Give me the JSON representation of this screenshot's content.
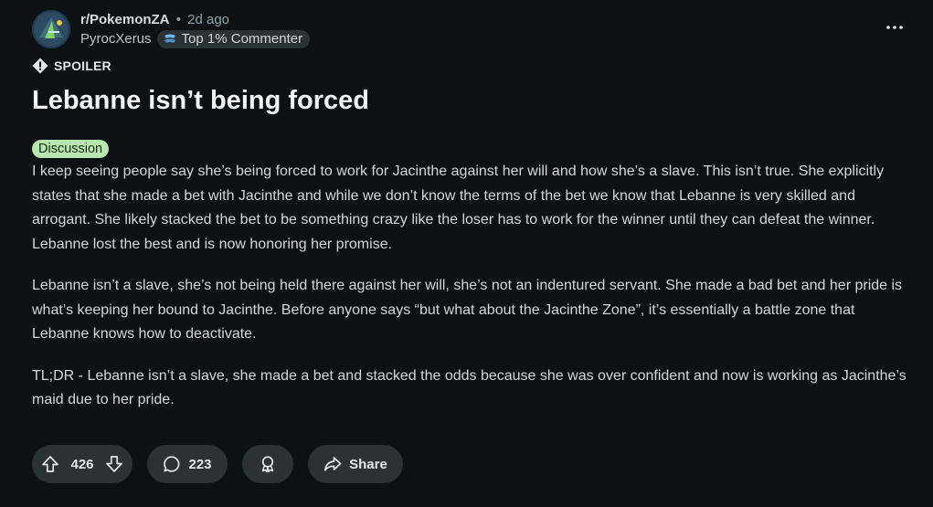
{
  "post": {
    "subreddit": "r/PokemonZA",
    "separator": "•",
    "time": "2d ago",
    "author": "PyrocXerus",
    "author_badge": "Top 1% Commenter",
    "spoiler_label": "SPOILER",
    "title": "Lebanne isn’t being forced",
    "flair": "Discussion",
    "paragraphs": [
      "I keep seeing people say she’s being forced to work for Jacinthe against her will and how she’s a slave. This isn’t true. She explicitly states that she made a bet with Jacinthe and while we don’t know the terms of the bet we know that Lebanne is very skilled and arrogant. She likely stacked the bet to be something crazy like the loser has to work for the winner until they can defeat the winner. Lebanne lost the best and is now honoring her promise.",
      "Lebanne isn’t a slave, she’s not being held there against her will, she’s not an indentured servant. She made a bad bet and her pride is what’s keeping her bound to Jacinthe. Before anyone says “but what about the Jacinthe Zone”, it’s essentially a battle zone that Lebanne knows how to deactivate.",
      "TL;DR - Lebanne isn’t a slave, she made a bet and stacked the odds because she was over confident and now is working as Jacinthe’s maid due to her pride."
    ]
  },
  "actions": {
    "votes": "426",
    "comments": "223",
    "share_label": "Share"
  },
  "icons": {
    "more": "more-horizontal-icon",
    "spoiler": "warning-diamond-icon",
    "badge": "commenter-badge-icon",
    "upvote": "upvote-arrow-icon",
    "downvote": "downvote-arrow-icon",
    "comment": "comment-bubble-icon",
    "award": "award-icon",
    "share": "share-arrow-icon"
  },
  "colors": {
    "background": "#0e1113",
    "pill": "#2a3236",
    "flair_bg": "#b8e6b0",
    "text": "#e2e6e9"
  }
}
